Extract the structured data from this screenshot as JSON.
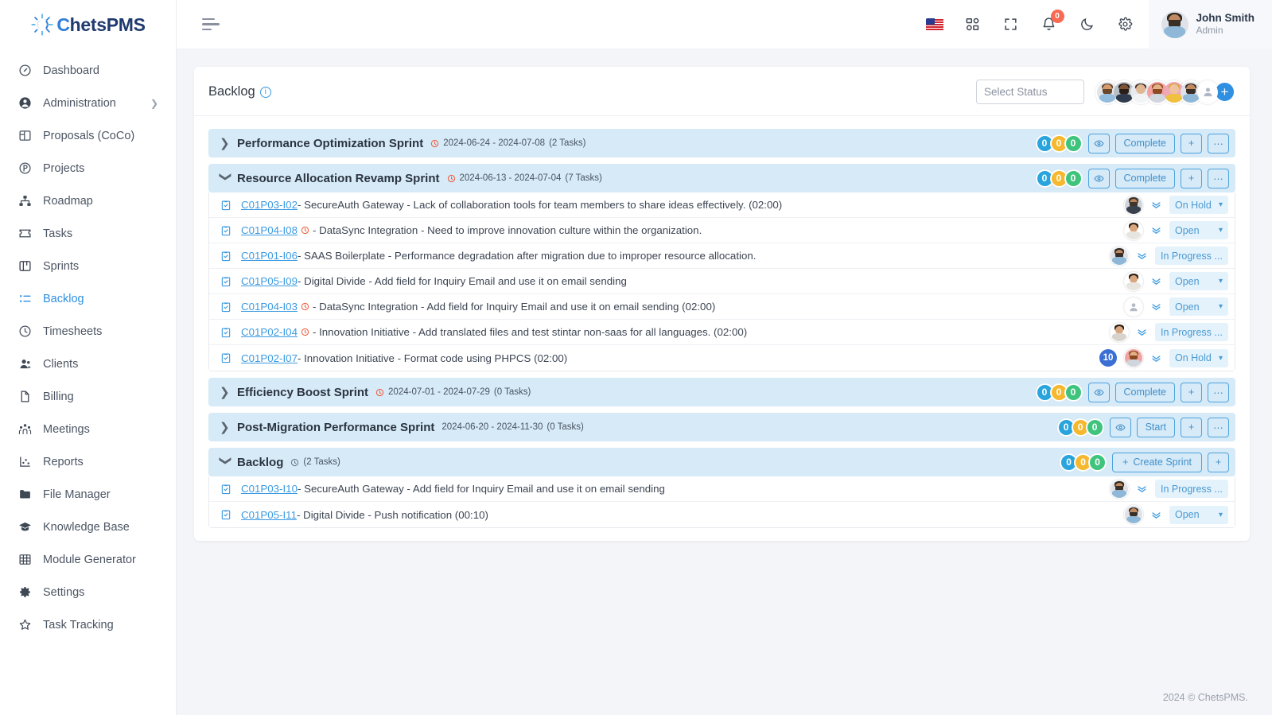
{
  "brand": {
    "name_prefix": "C",
    "name_rest": "hetsPMS",
    "full": "ChetsPMS"
  },
  "sidebar": {
    "items": [
      {
        "label": "Dashboard",
        "icon": "gauge-icon",
        "active": false,
        "chevron": false
      },
      {
        "label": "Administration",
        "icon": "user-circle-icon",
        "active": false,
        "chevron": true
      },
      {
        "label": "Proposals (CoCo)",
        "icon": "layout-icon",
        "active": false,
        "chevron": false
      },
      {
        "label": "Projects",
        "icon": "p-circle-icon",
        "active": false,
        "chevron": false
      },
      {
        "label": "Roadmap",
        "icon": "sitemap-icon",
        "active": false,
        "chevron": false
      },
      {
        "label": "Tasks",
        "icon": "ticket-icon",
        "active": false,
        "chevron": false
      },
      {
        "label": "Sprints",
        "icon": "board-icon",
        "active": false,
        "chevron": false
      },
      {
        "label": "Backlog",
        "icon": "list-check-icon",
        "active": true,
        "chevron": false
      },
      {
        "label": "Timesheets",
        "icon": "clock-icon",
        "active": false,
        "chevron": false
      },
      {
        "label": "Clients",
        "icon": "users-icon",
        "active": false,
        "chevron": false
      },
      {
        "label": "Billing",
        "icon": "file-icon",
        "active": false,
        "chevron": false
      },
      {
        "label": "Meetings",
        "icon": "people-group-icon",
        "active": false,
        "chevron": false
      },
      {
        "label": "Reports",
        "icon": "chart-scatter-icon",
        "active": false,
        "chevron": false
      },
      {
        "label": "File Manager",
        "icon": "folder-icon",
        "active": false,
        "chevron": false
      },
      {
        "label": "Knowledge Base",
        "icon": "graduation-cap-icon",
        "active": false,
        "chevron": false
      },
      {
        "label": "Module Generator",
        "icon": "grid-table-icon",
        "active": false,
        "chevron": false
      },
      {
        "label": "Settings",
        "icon": "gear-icon",
        "active": false,
        "chevron": false
      },
      {
        "label": "Task Tracking",
        "icon": "star-icon",
        "active": false,
        "chevron": false
      }
    ]
  },
  "topbar": {
    "menu_icon": "hamburger-icon",
    "language_icon": "us-flag-icon",
    "apps_icon": "grid-apps-icon",
    "fullscreen_icon": "fullscreen-icon",
    "notifications_icon": "bell-icon",
    "notifications_count": "0",
    "theme_icon": "moon-icon",
    "settings_icon": "gear-icon",
    "user": {
      "name": "John Smith",
      "role": "Admin"
    }
  },
  "page": {
    "title": "Backlog",
    "info_icon": "info-icon",
    "status_filter_placeholder": "Select Status",
    "status_filter_value": "",
    "add_member_label": "+",
    "team_avatars": 7
  },
  "colors": {
    "accent": "#2f8fe0",
    "count_blue": "#29a4dd",
    "count_yellow": "#f5b82e",
    "count_green": "#3fc47d",
    "group_header_bg": "#d6eaf8",
    "badge_red": "#f96a53",
    "clock_red": "#ef5a3c",
    "num_badge_blue": "#3b6fd4"
  },
  "groups": [
    {
      "name": "Performance Optimization Sprint",
      "expanded": false,
      "caret": "chevron-right-icon",
      "has_clock": true,
      "dates": "2024-06-24 - 2024-07-08",
      "task_count_label": "(2 Tasks)",
      "counts": [
        "0",
        "0",
        "0"
      ],
      "buttons": [
        {
          "name": "eye-button",
          "label": "",
          "icon": "eye-icon"
        },
        {
          "name": "complete-button",
          "label": "Complete",
          "icon": ""
        },
        {
          "name": "add-button",
          "label": "+",
          "icon": ""
        },
        {
          "name": "more-button",
          "label": "⋯",
          "icon": ""
        }
      ],
      "tasks": []
    },
    {
      "name": "Resource Allocation Revamp Sprint",
      "expanded": true,
      "caret": "chevron-down-icon",
      "has_clock": true,
      "dates": "2024-06-13 - 2024-07-04",
      "task_count_label": "(7 Tasks)",
      "counts": [
        "0",
        "0",
        "0"
      ],
      "buttons": [
        {
          "name": "eye-button",
          "label": "",
          "icon": "eye-icon"
        },
        {
          "name": "complete-button",
          "label": "Complete",
          "icon": ""
        },
        {
          "name": "add-button",
          "label": "+",
          "icon": ""
        },
        {
          "name": "more-button",
          "label": "⋯",
          "icon": ""
        }
      ],
      "tasks": [
        {
          "id": "C01P03-I02",
          "clock": false,
          "text": " - SecureAuth Gateway - Lack of collaboration tools for team members to share ideas effectively. (02:00)",
          "num_badge": "",
          "avatar": "m1",
          "status": "On Hold"
        },
        {
          "id": "C01P04-I08",
          "clock": true,
          "text": " - DataSync Integration - Need to improve innovation culture within the organization.",
          "num_badge": "",
          "avatar": "f1",
          "status": "Open"
        },
        {
          "id": "C01P01-I06",
          "clock": false,
          "text": " - SAAS Boilerplate - Performance degradation after migration due to improper resource allocation.",
          "num_badge": "",
          "avatar": "m2",
          "status": "In Progress ..."
        },
        {
          "id": "C01P05-I09",
          "clock": false,
          "text": " - Digital Divide - Add field for Inquiry Email and use it on email sending",
          "num_badge": "",
          "avatar": "f1",
          "status": "Open"
        },
        {
          "id": "C01P04-I03",
          "clock": true,
          "text": " - DataSync Integration - Add field for Inquiry Email and use it on email sending (02:00)",
          "num_badge": "",
          "avatar": "none",
          "status": "Open"
        },
        {
          "id": "C01P02-I04",
          "clock": true,
          "text": " - Innovation Initiative - Add translated files and test stintar non-saas for all languages. (02:00)",
          "num_badge": "",
          "avatar": "f2",
          "status": "In Progress ..."
        },
        {
          "id": "C01P02-I07",
          "clock": false,
          "text": " - Innovation Initiative - Format code using PHPCS (02:00)",
          "num_badge": "10",
          "avatar": "m3",
          "status": "On Hold"
        }
      ]
    },
    {
      "name": "Efficiency Boost Sprint",
      "expanded": false,
      "caret": "chevron-right-icon",
      "has_clock": true,
      "dates": "2024-07-01 - 2024-07-29",
      "task_count_label": "(0 Tasks)",
      "counts": [
        "0",
        "0",
        "0"
      ],
      "buttons": [
        {
          "name": "eye-button",
          "label": "",
          "icon": "eye-icon"
        },
        {
          "name": "complete-button",
          "label": "Complete",
          "icon": ""
        },
        {
          "name": "add-button",
          "label": "+",
          "icon": ""
        },
        {
          "name": "more-button",
          "label": "⋯",
          "icon": ""
        }
      ],
      "tasks": []
    },
    {
      "name": "Post-Migration Performance Sprint",
      "expanded": false,
      "caret": "chevron-right-icon",
      "has_clock": false,
      "dates": "2024-06-20 - 2024-11-30",
      "task_count_label": "(0 Tasks)",
      "counts": [
        "0",
        "0",
        "0"
      ],
      "buttons": [
        {
          "name": "eye-button",
          "label": "",
          "icon": "eye-icon"
        },
        {
          "name": "start-button",
          "label": "Start",
          "icon": ""
        },
        {
          "name": "add-button",
          "label": "+",
          "icon": ""
        },
        {
          "name": "more-button",
          "label": "⋯",
          "icon": ""
        }
      ],
      "tasks": []
    },
    {
      "name": "Backlog",
      "expanded": true,
      "caret": "chevron-down-icon",
      "has_clock": true,
      "dates": "",
      "task_count_label": "(2 Tasks)",
      "counts": [
        "0",
        "0",
        "0"
      ],
      "buttons": [
        {
          "name": "create-sprint-button",
          "label": "Create Sprint",
          "icon": "plus-icon"
        },
        {
          "name": "add-button",
          "label": "+",
          "icon": ""
        }
      ],
      "tasks": [
        {
          "id": "C01P03-I10",
          "clock": false,
          "text": " - SecureAuth Gateway - Add field for Inquiry Email and use it on email sending",
          "num_badge": "",
          "avatar": "m2",
          "status": "In Progress ..."
        },
        {
          "id": "C01P05-I11",
          "clock": false,
          "text": " - Digital Divide - Push notification (00:10)",
          "num_badge": "",
          "avatar": "m2",
          "status": "Open"
        }
      ]
    }
  ],
  "footer": {
    "text": "2024 © ChetsPMS."
  }
}
